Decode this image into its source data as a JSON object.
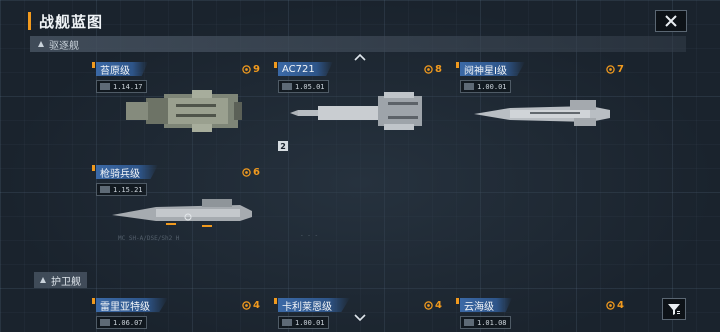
{
  "title": "战舰蓝图",
  "colors": {
    "accent": "#f19a1e",
    "name_plate": "#3b69a6",
    "background": "#1a232d"
  },
  "sections": [
    {
      "label": "驱逐舰"
    },
    {
      "label": "护卫舰"
    }
  ],
  "destroyers": [
    {
      "name": "苔原级",
      "stars": "9",
      "stat": "1.14.17"
    },
    {
      "name": "AC721",
      "stars": "8",
      "stat": "1.05.01",
      "badge": "2"
    },
    {
      "name": "阋神星I级",
      "stars": "7",
      "stat": "1.00.01"
    },
    {
      "name": "枪骑兵级",
      "stars": "6",
      "stat": "1.15.21"
    }
  ],
  "frigates": [
    {
      "name": "雷里亚特级",
      "stars": "4",
      "stat": "1.06.07"
    },
    {
      "name": "卡利莱恩级",
      "stars": "4",
      "stat": "1.00.01"
    },
    {
      "name": "云海级",
      "stars": "4",
      "stat": "1.01.08"
    }
  ],
  "icons": {
    "close": "close-icon",
    "filter": "filter-icon",
    "scroll_up": "chevron-up-icon",
    "scroll_down": "chevron-down-icon",
    "star": "star-icon"
  }
}
